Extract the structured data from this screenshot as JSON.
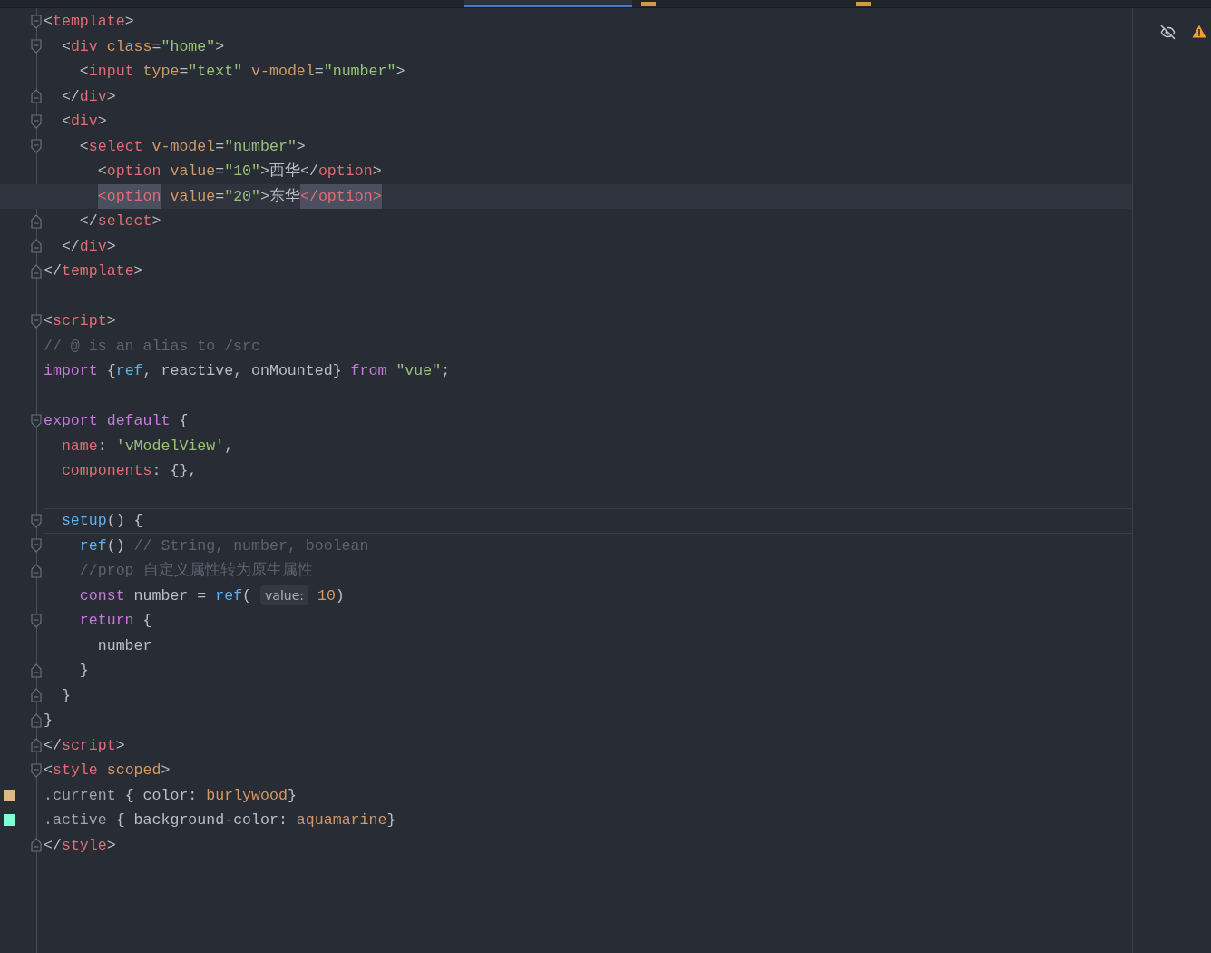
{
  "tab_bar": {
    "tabs": [
      {
        "selected": true,
        "icon": false
      },
      {
        "selected": false,
        "icon": true
      },
      {
        "selected": false,
        "icon": true
      }
    ]
  },
  "editor": {
    "blocks": [
      {
        "lines": [
          {
            "fold": {
              "kind": "open"
            },
            "tokens": [
              {
                "t": "<",
                "kind": "punct"
              },
              {
                "t": "template",
                "kind": "tag"
              },
              {
                "t": ">",
                "kind": "punct"
              }
            ]
          },
          {
            "fold": {
              "kind": "open"
            },
            "tokens": [
              {
                "t": "  <",
                "kind": "punct"
              },
              {
                "t": "div",
                "kind": "tag"
              },
              {
                "t": " class",
                "kind": "attr"
              },
              {
                "t": "=",
                "kind": "punct"
              },
              {
                "t": "\"home\"",
                "kind": "string"
              },
              {
                "t": ">",
                "kind": "punct"
              }
            ]
          },
          {
            "tokens": [
              {
                "t": "    <",
                "kind": "punct"
              },
              {
                "t": "input",
                "kind": "tag"
              },
              {
                "t": " type",
                "kind": "attr"
              },
              {
                "t": "=",
                "kind": "punct"
              },
              {
                "t": "\"text\"",
                "kind": "string"
              },
              {
                "t": " v-model",
                "kind": "attr"
              },
              {
                "t": "=",
                "kind": "punct"
              },
              {
                "t": "\"number\"",
                "kind": "string"
              },
              {
                "t": ">",
                "kind": "punct"
              }
            ]
          },
          {
            "fold": {
              "kind": "close"
            },
            "tokens": [
              {
                "t": "  </",
                "kind": "punct"
              },
              {
                "t": "div",
                "kind": "tag"
              },
              {
                "t": ">",
                "kind": "punct"
              }
            ]
          },
          {
            "fold": {
              "kind": "open"
            },
            "tokens": [
              {
                "t": "  <",
                "kind": "punct"
              },
              {
                "t": "div",
                "kind": "tag"
              },
              {
                "t": ">",
                "kind": "punct"
              }
            ]
          },
          {
            "fold": {
              "kind": "open"
            },
            "tokens": [
              {
                "t": "    <",
                "kind": "punct"
              },
              {
                "t": "select",
                "kind": "tag"
              },
              {
                "t": " v-model",
                "kind": "attr"
              },
              {
                "t": "=",
                "kind": "punct"
              },
              {
                "t": "\"number\"",
                "kind": "string"
              },
              {
                "t": ">",
                "kind": "punct"
              }
            ]
          },
          {
            "tokens": [
              {
                "t": "      <",
                "kind": "punct"
              },
              {
                "t": "option",
                "kind": "tag"
              },
              {
                "t": " value",
                "kind": "attr"
              },
              {
                "t": "=",
                "kind": "punct"
              },
              {
                "t": "\"10\"",
                "kind": "string"
              },
              {
                "t": ">西华</",
                "kind": "punct"
              },
              {
                "t": "option",
                "kind": "tag"
              },
              {
                "t": ">",
                "kind": "punct"
              }
            ]
          },
          {
            "current": true,
            "tokens": [
              {
                "t": "      <option",
                "kind": "tag",
                "matched": true
              },
              {
                "t": " value",
                "kind": "attr"
              },
              {
                "t": "=",
                "kind": "punct"
              },
              {
                "t": "\"20\"",
                "kind": "string"
              },
              {
                "t": ">东华",
                "kind": "punct"
              },
              {
                "t": "</option>",
                "kind": "tag",
                "matched": true
              }
            ]
          },
          {
            "fold": {
              "kind": "close"
            },
            "tokens": [
              {
                "t": "    </",
                "kind": "punct"
              },
              {
                "t": "select",
                "kind": "tag"
              },
              {
                "t": ">",
                "kind": "punct"
              }
            ]
          },
          {
            "fold": {
              "kind": "close"
            },
            "tokens": [
              {
                "t": "  </",
                "kind": "punct"
              },
              {
                "t": "div",
                "kind": "tag"
              },
              {
                "t": ">",
                "kind": "punct"
              }
            ]
          },
          {
            "fold": {
              "kind": "close"
            },
            "tokens": [
              {
                "t": "</",
                "kind": "punct"
              },
              {
                "t": "template",
                "kind": "tag"
              },
              {
                "t": ">",
                "kind": "punct"
              }
            ]
          }
        ]
      },
      {
        "lines": [
          {
            "fold": {
              "kind": "open"
            },
            "tokens": [
              {
                "t": "<",
                "kind": "punct"
              },
              {
                "t": "script",
                "kind": "tag"
              },
              {
                "t": ">",
                "kind": "punct"
              }
            ]
          },
          {
            "tokens": [
              {
                "t": "// @ is an alias to /src",
                "kind": "comment"
              }
            ]
          },
          {
            "tokens": [
              {
                "t": "import",
                "kind": "keyword"
              },
              {
                "t": " {",
                "kind": "punct"
              },
              {
                "t": "ref",
                "kind": "func"
              },
              {
                "t": ", reactive, onMounted} ",
                "kind": "punct"
              },
              {
                "t": "from",
                "kind": "keyword"
              },
              {
                "t": " \"vue\"",
                "kind": "string"
              },
              {
                "t": ";",
                "kind": "punct"
              }
            ]
          }
        ]
      },
      {
        "lines": [
          {
            "fold": {
              "kind": "open"
            },
            "tokens": [
              {
                "t": "export default",
                "kind": "keyword"
              },
              {
                "t": " {",
                "kind": "punct"
              }
            ]
          },
          {
            "tokens": [
              {
                "t": "  name",
                "kind": "tag"
              },
              {
                "t": ": ",
                "kind": "punct"
              },
              {
                "t": "'vModelView'",
                "kind": "string"
              },
              {
                "t": ",",
                "kind": "punct"
              }
            ]
          },
          {
            "tokens": [
              {
                "t": "  components",
                "kind": "tag"
              },
              {
                "t": ": {},",
                "kind": "punct"
              }
            ]
          }
        ]
      },
      {
        "lines": [
          {
            "fold": {
              "kind": "open"
            },
            "separator": true,
            "tokens": [
              {
                "t": "  setup",
                "kind": "func"
              },
              {
                "t": "() {",
                "kind": "punct"
              }
            ]
          },
          {
            "fold": {
              "kind": "open"
            },
            "tokens": [
              {
                "t": "    ref",
                "kind": "func"
              },
              {
                "t": "() ",
                "kind": "punct"
              },
              {
                "t": "// String, number, boolean",
                "kind": "comment"
              }
            ]
          },
          {
            "fold": {
              "kind": "close"
            },
            "tokens": [
              {
                "t": "    //prop 自定义属性转为原生属性",
                "kind": "comment"
              }
            ]
          },
          {
            "tokens": [
              {
                "t": "    const",
                "kind": "keyword"
              },
              {
                "t": " number = ",
                "kind": "punct"
              },
              {
                "t": "ref",
                "kind": "func"
              },
              {
                "t": "( ",
                "kind": "punct"
              },
              {
                "t": "value:",
                "kind": "hint"
              },
              {
                "t": " 10",
                "kind": "number"
              },
              {
                "t": ")",
                "kind": "punct"
              }
            ]
          },
          {
            "fold": {
              "kind": "open"
            },
            "tokens": [
              {
                "t": "    return",
                "kind": "keyword"
              },
              {
                "t": " {",
                "kind": "punct"
              }
            ]
          },
          {
            "tokens": [
              {
                "t": "      number",
                "kind": "punct"
              }
            ]
          },
          {
            "fold": {
              "kind": "close"
            },
            "tokens": [
              {
                "t": "    }",
                "kind": "punct"
              }
            ]
          },
          {
            "fold": {
              "kind": "close"
            },
            "tokens": [
              {
                "t": "  }",
                "kind": "punct"
              }
            ]
          },
          {
            "fold": {
              "kind": "close"
            },
            "tokens": [
              {
                "t": "}",
                "kind": "punct"
              }
            ]
          },
          {
            "fold": {
              "kind": "close"
            },
            "tokens": [
              {
                "t": "</",
                "kind": "punct"
              },
              {
                "t": "script",
                "kind": "tag"
              },
              {
                "t": ">",
                "kind": "punct"
              }
            ]
          },
          {
            "fold": {
              "kind": "open"
            },
            "tokens": [
              {
                "t": "<",
                "kind": "punct"
              },
              {
                "t": "style",
                "kind": "tag"
              },
              {
                "t": " scoped",
                "kind": "attr"
              },
              {
                "t": ">",
                "kind": "punct"
              }
            ]
          },
          {
            "color": "#deb887",
            "tokens": [
              {
                "t": ".current",
                "kind": "selector"
              },
              {
                "t": " { color: ",
                "kind": "punct"
              },
              {
                "t": "burlywood",
                "kind": "number"
              },
              {
                "t": "}",
                "kind": "punct"
              }
            ]
          },
          {
            "color": "#7fffd4",
            "tokens": [
              {
                "t": ".active",
                "kind": "selector"
              },
              {
                "t": " { background-color: ",
                "kind": "punct"
              },
              {
                "t": "aquamarine",
                "kind": "number"
              },
              {
                "t": "}",
                "kind": "punct"
              }
            ]
          },
          {
            "fold": {
              "kind": "close"
            },
            "tokens": [
              {
                "t": "</",
                "kind": "punct"
              },
              {
                "t": "style",
                "kind": "tag"
              },
              {
                "t": ">",
                "kind": "punct"
              }
            ]
          }
        ]
      }
    ]
  }
}
